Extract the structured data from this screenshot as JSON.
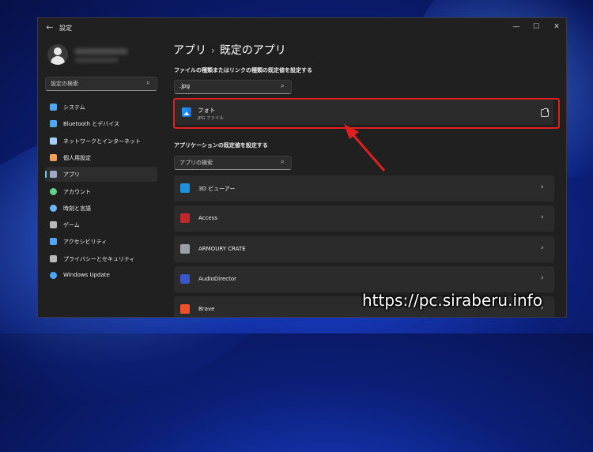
{
  "window": {
    "title": "設定",
    "back_glyph": "←",
    "minimize_glyph": "—",
    "maximize_glyph": "☐",
    "close_glyph": "✕"
  },
  "sidebar": {
    "search_placeholder": "設定の検索",
    "items": [
      {
        "label": "システム",
        "icon": "monitor-icon",
        "active": false
      },
      {
        "label": "Bluetooth とデバイス",
        "icon": "bluetooth-icon",
        "active": false
      },
      {
        "label": "ネットワークとインターネット",
        "icon": "wifi-icon",
        "active": false
      },
      {
        "label": "個人用設定",
        "icon": "pen-icon",
        "active": false
      },
      {
        "label": "アプリ",
        "icon": "apps-icon",
        "active": true
      },
      {
        "label": "アカウント",
        "icon": "person-icon",
        "active": false
      },
      {
        "label": "時刻と言語",
        "icon": "globe-clock-icon",
        "active": false
      },
      {
        "label": "ゲーム",
        "icon": "gamepad-icon",
        "active": false
      },
      {
        "label": "アクセシビリティ",
        "icon": "accessibility-icon",
        "active": false
      },
      {
        "label": "プライバシーとセキュリティ",
        "icon": "shield-icon",
        "active": false
      },
      {
        "label": "Windows Update",
        "icon": "update-icon",
        "active": false
      }
    ]
  },
  "main": {
    "breadcrumb_parent": "アプリ",
    "breadcrumb_sep": "›",
    "breadcrumb_current": "既定のアプリ",
    "filetype_section_title": "ファイルの種類またはリンクの種類の既定値を設定する",
    "filetype_search_value": ".jpg",
    "result": {
      "name": "フォト",
      "description": "JPG ファイル"
    },
    "apps_section_title": "アプリケーションの既定値を設定する",
    "apps_search_placeholder": "アプリの検索",
    "apps": [
      {
        "label": "3D ビューアー",
        "icon": "3d-viewer-icon",
        "color": "#1f8fe0"
      },
      {
        "label": "Access",
        "icon": "access-icon",
        "color": "#c4262e"
      },
      {
        "label": "ARMOURY CRATE",
        "icon": "armoury-crate-icon",
        "color": "#9aa0a8"
      },
      {
        "label": "AudioDirector",
        "icon": "audiodirector-icon",
        "color": "#3a57c9"
      },
      {
        "label": "Brave",
        "icon": "brave-icon",
        "color": "#f0512a"
      }
    ],
    "chevron_glyph": "›"
  },
  "watermark": "https://pc.siraberu.info",
  "colors": {
    "accent": "#60cdff",
    "highlight": "#e0201f"
  }
}
